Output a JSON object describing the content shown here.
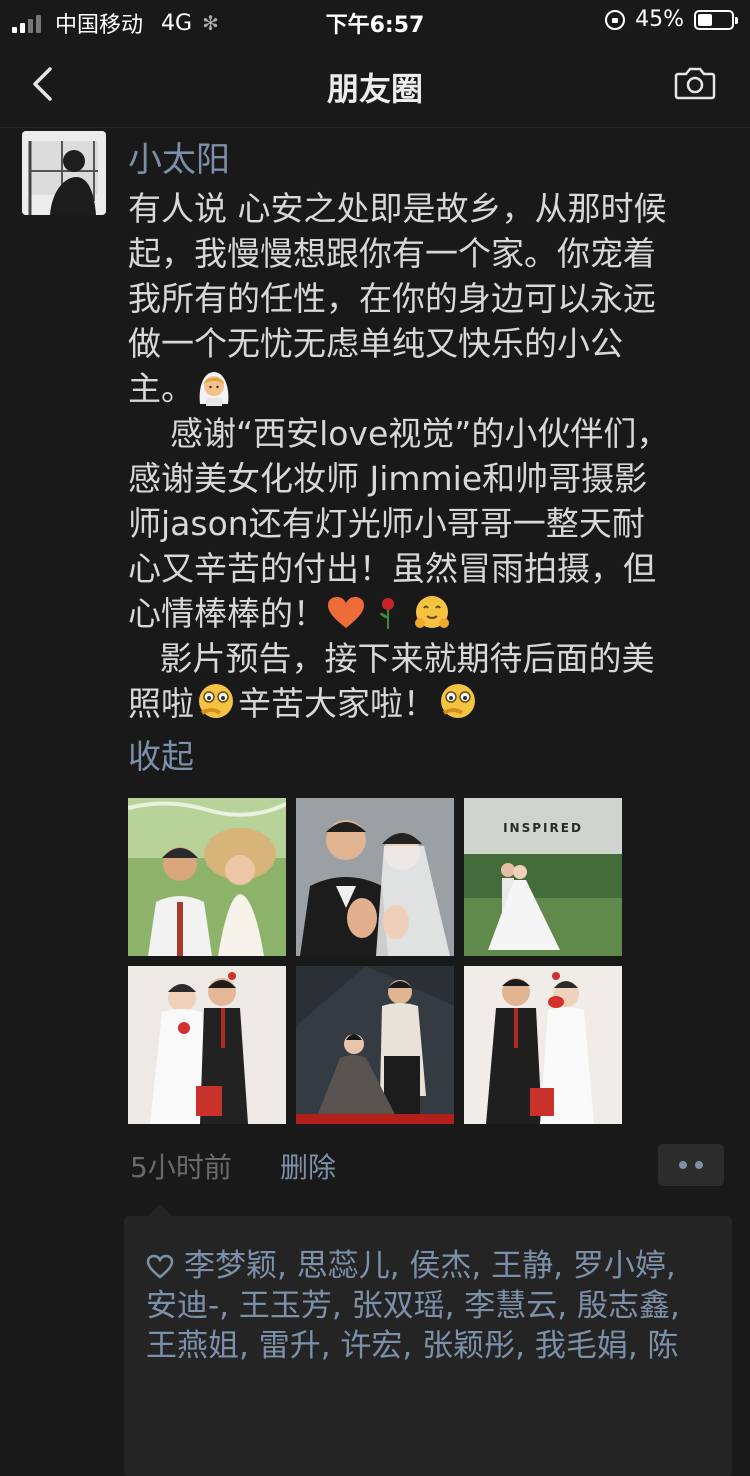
{
  "status_bar": {
    "carrier": "中国移动",
    "network": "4G",
    "time": "下午6:57",
    "battery": "45%",
    "battery_level": 0.45
  },
  "nav": {
    "title": "朋友圈",
    "back_icon": "chevron-left-icon",
    "camera_icon": "camera-icon"
  },
  "post": {
    "author": "小太阳",
    "text_lines": [
      "有人说 心安之处即是故乡，从那时候",
      "起，我慢慢想跟你有一个家。你宠着",
      "我所有的任性，在你的身边可以永远",
      "做一个无忧无虑单纯又快乐的小公",
      "主。",
      "    感谢“西安love视觉”的小伙伴们，",
      "感谢美女化妆师 Jimmie和帅哥摄影",
      "师jason还有灯光师小哥哥一整天耐",
      "心又辛苦的付出！虽然冒雨拍摄，但",
      "心情棒棒的！",
      "   影片预告，接下来就期待后面的美",
      "照啦",
      "辛苦大家啦！"
    ],
    "collapse_label": "收起",
    "photo_3_text": "INSPIRED",
    "time_ago": "5小时前",
    "delete_label": "删除",
    "likes_text": "李梦颖, 思蕊儿, 侯杰, 王静, 罗小婷, 安迪-, 王玉芳, 张双瑶, 李慧云, 殷志鑫, 王燕姐, 雷升, 许宏, 张颖彤, 我毛娟, 陈"
  },
  "colors": {
    "background": "#191919",
    "link": "#7d90a9",
    "text": "#d8d8d8"
  }
}
